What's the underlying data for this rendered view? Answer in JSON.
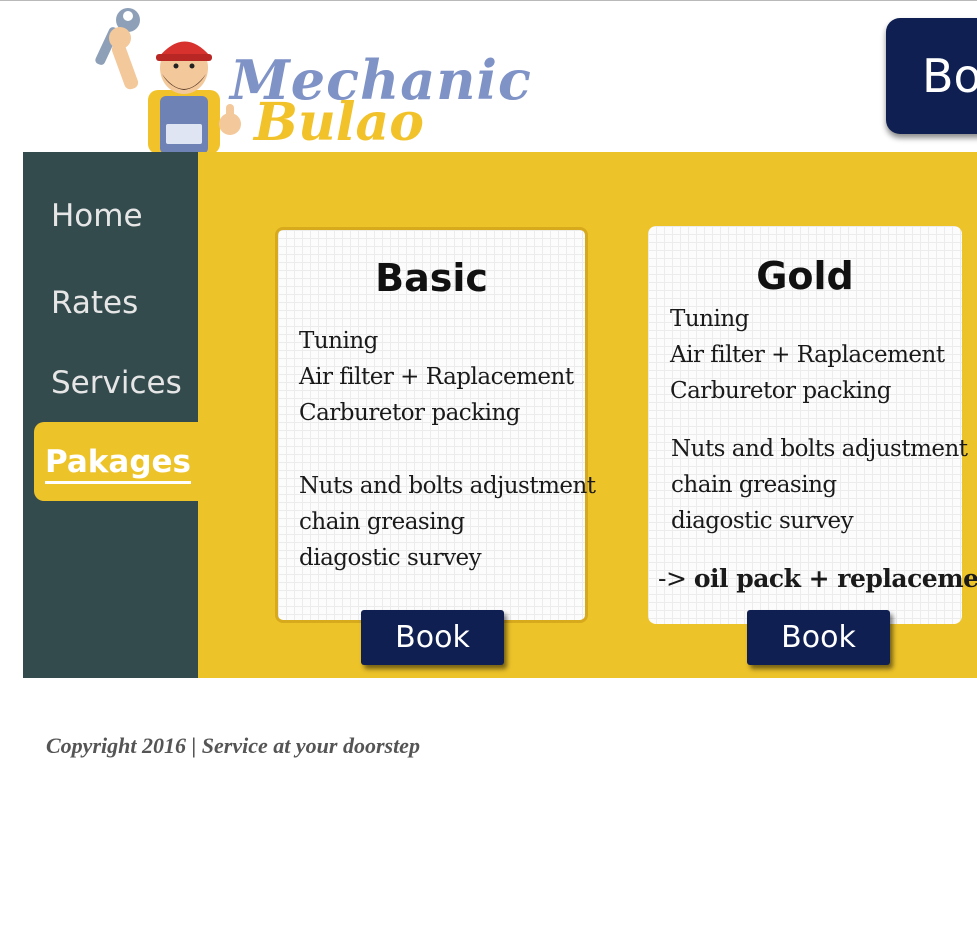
{
  "brand": {
    "line1": "Mechanic",
    "line2": "Bulao",
    "colors": {
      "line1": "#7f93c7",
      "line2": "#f2c22a"
    }
  },
  "header": {
    "book_label": "Book"
  },
  "nav": {
    "items": [
      {
        "label": "Home"
      },
      {
        "label": "Rates"
      },
      {
        "label": "Services"
      },
      {
        "label": "Pakages",
        "active": true
      }
    ]
  },
  "packages": [
    {
      "title": "Basic",
      "features_group1": [
        "Tuning",
        "Air filter + Raplacement",
        "Carburetor packing"
      ],
      "features_group2": [
        "Nuts and bolts adjustment",
        "chain greasing",
        "diagostic survey"
      ],
      "book_label": "Book"
    },
    {
      "title": "Gold",
      "features_group1": [
        "Tuning",
        "Air filter + Raplacement",
        "Carburetor packing"
      ],
      "features_group2": [
        "Nuts and bolts adjustment",
        "chain greasing",
        "diagostic survey"
      ],
      "extra_prefix": "->",
      "extra_label": "oil pack + replacement",
      "book_label": "Book"
    }
  ],
  "footer": {
    "text": "Copyright 2016 | Service at your doorstep"
  },
  "colors": {
    "sidebar": "#344b4e",
    "accent_yellow": "#edc32a",
    "button_navy": "#0f1f52"
  }
}
